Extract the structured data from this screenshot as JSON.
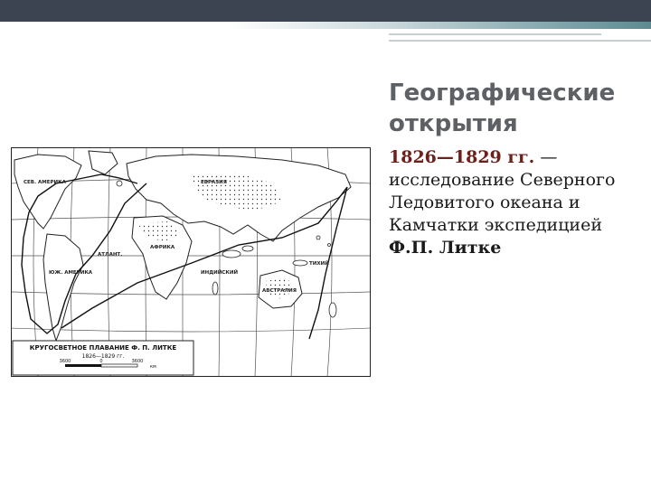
{
  "slide": {
    "title": "Географические открытия",
    "body": {
      "years": "1826—1829 гг.",
      "dash": " — ",
      "text": "исследование Северного Ледовитого океана и Камчатки экспедицией ",
      "name": "Ф.П. Литке"
    }
  },
  "map": {
    "legend_title": "КРУГОСВЕТНОЕ ПЛАВАНИЕ Ф. П. ЛИТКЕ",
    "legend_years": "1826—1829 гг.",
    "scale_left": "3600",
    "scale_mid": "0",
    "scale_right": "3600",
    "scale_unit": "км",
    "labels": {
      "eurasia": "ЕВРАЗИЯ",
      "africa": "АФРИКА",
      "north_america": "СЕВ. АМЕРИКА",
      "south_america": "ЮЖ. АМЕРИКА",
      "australia": "АВСТРАЛИЯ",
      "indian_ocean": "ИНДИЙСКИЙ",
      "pacific_ocean": "ТИХИЙ",
      "atlantic_ocean": "АТЛАНТ."
    }
  }
}
